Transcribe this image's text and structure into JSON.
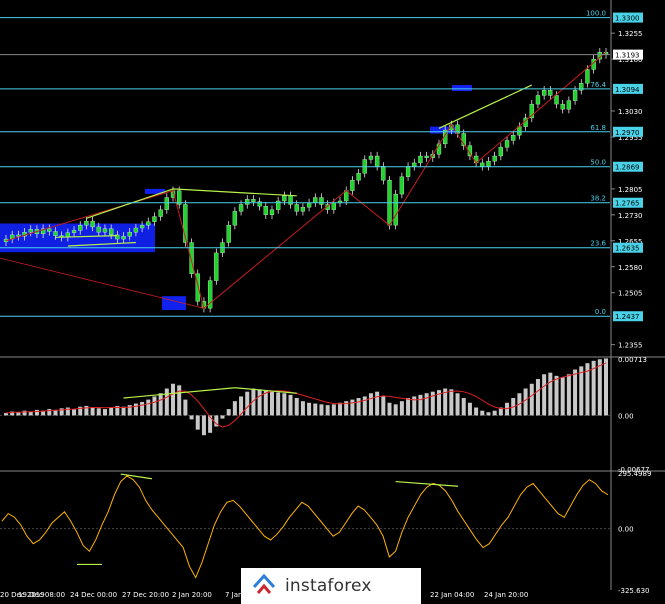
{
  "colors": {
    "bg": "#000000",
    "bull": "#1fd42a",
    "bear": "#1fd42a",
    "wick": "#ffffff",
    "level": "#4ad2e8",
    "zone": "#1122ee",
    "trend": "#b8f24a",
    "red": "#c81e1e",
    "hist": "#c8c8c8",
    "signal": "#e02020",
    "osc": "#ffb400"
  },
  "chart_data": [
    {
      "type": "candlestick",
      "title": "",
      "y_ticks": [
        "1.3255",
        "1.3180",
        "1.3030",
        "1.2955",
        "1.2805",
        "1.2730",
        "1.2655",
        "1.2580",
        "1.2505",
        "1.2355"
      ],
      "y_tick_values": [
        1.3255,
        1.318,
        1.303,
        1.2955,
        1.2805,
        1.273,
        1.2655,
        1.258,
        1.2505,
        1.2355
      ],
      "ylim": [
        1.2325,
        1.3345
      ],
      "fib_levels": [
        {
          "label": "100.0",
          "price": 1.33,
          "tag": "1.3300"
        },
        {
          "label": "",
          "price": 1.3193,
          "tag": "1.3193"
        },
        {
          "label": "76.4",
          "price": 1.3094,
          "tag": "1.3094"
        },
        {
          "label": "61.8",
          "price": 1.297,
          "tag": "1.2970"
        },
        {
          "label": "50.0",
          "price": 1.2869,
          "tag": "1.2869"
        },
        {
          "label": "38.2",
          "price": 1.2765,
          "tag": "1.2765"
        },
        {
          "label": "23.6",
          "price": 1.2635,
          "tag": "1.2635"
        },
        {
          "label": "0.0",
          "price": 1.2437,
          "tag": "1.2437"
        }
      ],
      "closes": [
        1.266,
        1.2672,
        1.2668,
        1.268,
        1.2688,
        1.2675,
        1.269,
        1.2682,
        1.267,
        1.2665,
        1.2678,
        1.2685,
        1.27,
        1.2712,
        1.2695,
        1.268,
        1.269,
        1.2672,
        1.266,
        1.2668,
        1.268,
        1.2692,
        1.27,
        1.271,
        1.2725,
        1.2745,
        1.278,
        1.28,
        1.276,
        1.265,
        1.256,
        1.248,
        1.246,
        1.254,
        1.262,
        1.265,
        1.27,
        1.274,
        1.276,
        1.2775,
        1.2768,
        1.2755,
        1.273,
        1.2745,
        1.277,
        1.2785,
        1.276,
        1.274,
        1.2752,
        1.2765,
        1.278,
        1.276,
        1.2745,
        1.2765,
        1.277,
        1.28,
        1.283,
        1.285,
        1.289,
        1.29,
        1.287,
        1.283,
        1.27,
        1.279,
        1.284,
        1.287,
        1.288,
        1.29,
        1.2895,
        1.2905,
        1.2935,
        1.2975,
        1.299,
        1.2965,
        1.293,
        1.29,
        1.288,
        1.287,
        1.2885,
        1.29,
        1.2925,
        1.2945,
        1.296,
        1.2985,
        1.301,
        1.305,
        1.3075,
        1.309,
        1.3075,
        1.305,
        1.3035,
        1.306,
        1.309,
        1.311,
        1.315,
        1.318,
        1.32,
        1.3193
      ]
    },
    {
      "type": "histogram",
      "y_ticks": [
        "0.00713",
        "0.00",
        "-0.00677"
      ],
      "ylim": [
        -0.00677,
        0.00713
      ],
      "values": [
        0.0003,
        0.0005,
        0.0004,
        0.0006,
        0.0005,
        0.0007,
        0.0006,
        0.0008,
        0.0007,
        0.0009,
        0.001,
        0.0008,
        0.0011,
        0.0012,
        0.001,
        0.0009,
        0.0008,
        0.001,
        0.0012,
        0.0011,
        0.0013,
        0.0015,
        0.0017,
        0.002,
        0.0024,
        0.0028,
        0.0034,
        0.004,
        0.0038,
        0.002,
        -0.0005,
        -0.0018,
        -0.0025,
        -0.0022,
        -0.0014,
        -0.0004,
        0.0008,
        0.0018,
        0.0024,
        0.003,
        0.0034,
        0.0033,
        0.0031,
        0.003,
        0.0029,
        0.0028,
        0.0026,
        0.0022,
        0.0018,
        0.0016,
        0.0015,
        0.0014,
        0.0013,
        0.0014,
        0.0016,
        0.0018,
        0.002,
        0.0022,
        0.0024,
        0.0028,
        0.003,
        0.0024,
        0.0016,
        0.0014,
        0.0018,
        0.0022,
        0.0024,
        0.0026,
        0.0028,
        0.003,
        0.0032,
        0.0034,
        0.0033,
        0.0028,
        0.0022,
        0.0016,
        0.001,
        0.0006,
        0.0004,
        0.0006,
        0.001,
        0.0016,
        0.0022,
        0.0028,
        0.0034,
        0.004,
        0.0046,
        0.0052,
        0.0054,
        0.005,
        0.0048,
        0.0052,
        0.0058,
        0.0062,
        0.0066,
        0.0069,
        0.0071,
        0.0072
      ]
    },
    {
      "type": "line",
      "y_ticks": [
        "295.4989",
        "0.00",
        "-325.630"
      ],
      "ylim": [
        -325.63,
        295.4989
      ],
      "x_ticks": [
        "20 Dec 2019",
        "19 Dec 08:00",
        "24 Dec 00:00",
        "27 Dec 20:00",
        "2 Jan 20:00",
        "7 Jan",
        "22 Jan 04:00",
        "24 Jan 20:00"
      ],
      "values": [
        40,
        80,
        60,
        20,
        -40,
        -80,
        -60,
        -20,
        30,
        60,
        90,
        40,
        -20,
        -90,
        -120,
        -60,
        20,
        90,
        180,
        250,
        280,
        260,
        220,
        150,
        100,
        60,
        20,
        -20,
        -60,
        -100,
        -200,
        -260,
        -180,
        -80,
        20,
        90,
        140,
        150,
        120,
        80,
        40,
        0,
        -40,
        -60,
        -30,
        10,
        60,
        100,
        140,
        120,
        80,
        40,
        0,
        -40,
        -20,
        30,
        80,
        120,
        100,
        60,
        20,
        -40,
        -150,
        -120,
        -20,
        60,
        120,
        180,
        220,
        240,
        230,
        200,
        150,
        90,
        40,
        -10,
        -60,
        -100,
        -80,
        -30,
        20,
        60,
        120,
        180,
        220,
        240,
        200,
        160,
        120,
        80,
        60,
        120,
        180,
        230,
        260,
        240,
        200,
        180
      ]
    }
  ],
  "watermark": {
    "text": "instaforex"
  }
}
